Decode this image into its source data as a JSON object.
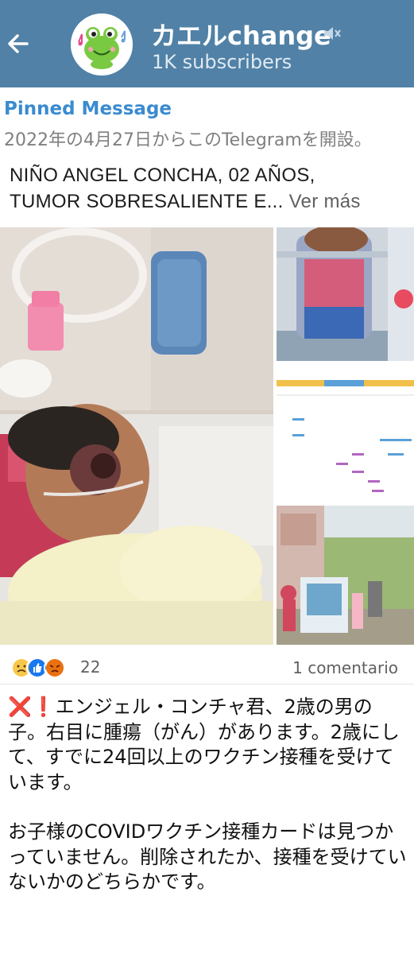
{
  "header": {
    "channel_name": "カエルchange",
    "subscribers": "1K subscribers",
    "colors": {
      "bar": "#5181a6",
      "text": "#ffffff"
    },
    "icons": [
      "back-arrow-icon",
      "frog-avatar",
      "muted-speaker-icon"
    ]
  },
  "pinned": {
    "label": "Pinned Message",
    "text": "2022年の4月27日からこのTelegramを開設。"
  },
  "post": {
    "title_line1": "NIÑO ANGEL CONCHA, 02 AÑOS,",
    "title_line2": "TUMOR SOBRESALIENTE E...",
    "ver_mas": "Ver más",
    "reactions_count": "22",
    "comments": "1 comentario",
    "reaction_icons": [
      "sad-face-icon",
      "thumbs-up-icon",
      "angry-face-icon"
    ]
  },
  "message": {
    "icon_x": "❌",
    "icon_exclaim": "❗",
    "p1": "エンジェル・コンチャ君、2歳の男の子。右目に腫瘍（がん）があります。2歳にして、すでに24回以上のワクチン接種を受けています。",
    "p2": "お子様のCOVIDワクチン接種カードは見つかっていません。削除されたか、接種を受けていないかのどちらかです。"
  }
}
